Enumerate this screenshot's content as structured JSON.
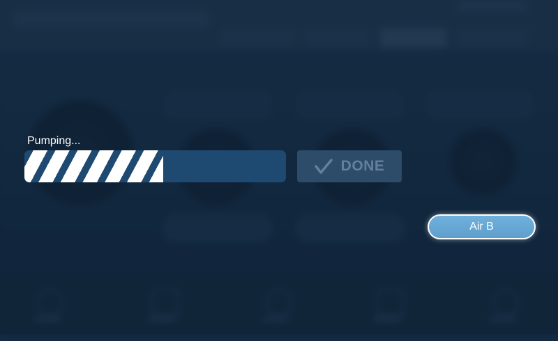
{
  "progress": {
    "status_label": "Pumping...",
    "fraction": 0.53
  },
  "done_button": {
    "label": "DONE",
    "icon": "checkmark-icon"
  },
  "air_button": {
    "label": "Air B"
  },
  "colors": {
    "progress_track": "#1e4a72",
    "progress_stripe": "#ffffff",
    "done_button_bg": "#2c4c69",
    "done_button_text": "#64809a",
    "air_button_bg": "#62a3cf",
    "background": "#183049"
  }
}
